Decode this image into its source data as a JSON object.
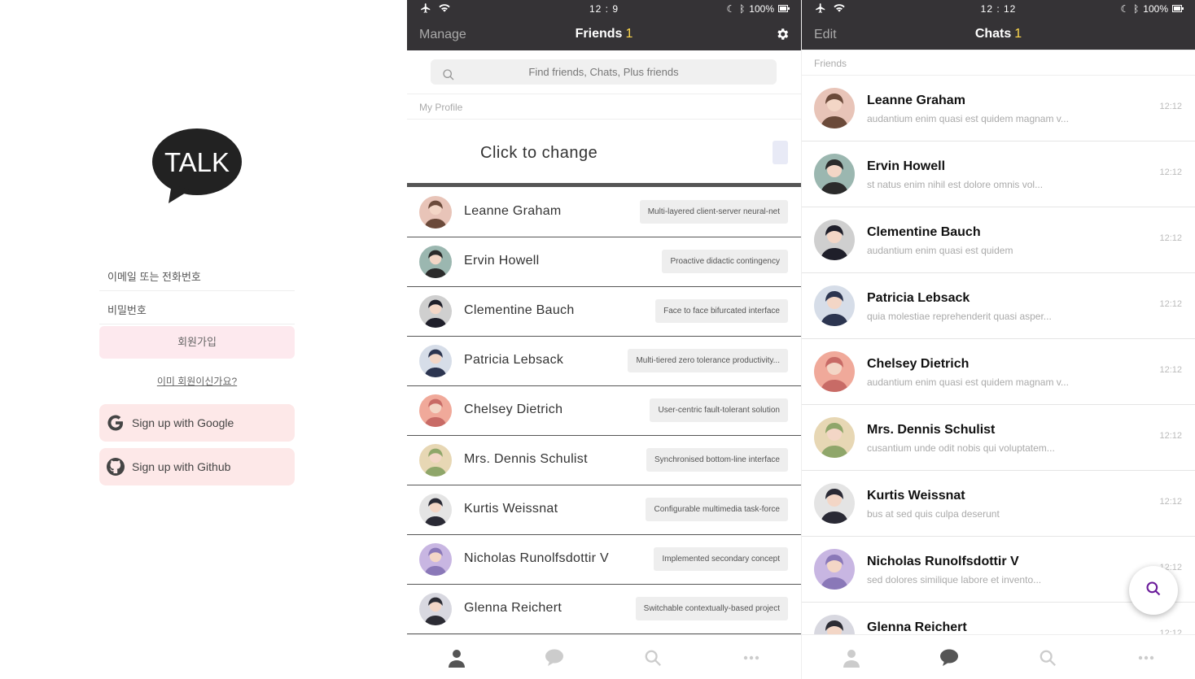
{
  "login": {
    "logo_text": "TALK",
    "email_placeholder": "이메일 또는 전화번호",
    "password_placeholder": "비밀번호",
    "signup_label": "회원가입",
    "already_member": "이미 회원이신가요?",
    "google_label": "Sign up with Google",
    "github_label": "Sign up with Github"
  },
  "friends_screen": {
    "status": {
      "time": "12 : 9",
      "battery": "100%"
    },
    "nav": {
      "left": "Manage",
      "title": "Friends",
      "count": "1"
    },
    "search_placeholder": "Find friends, Chats, Plus friends",
    "my_profile_label": "My Profile",
    "profile_text": "Click to change",
    "friends": [
      {
        "name": "Leanne Graham",
        "status": "Multi-layered client-server neural-net"
      },
      {
        "name": "Ervin Howell",
        "status": "Proactive didactic contingency"
      },
      {
        "name": "Clementine Bauch",
        "status": "Face to face bifurcated interface"
      },
      {
        "name": "Patricia Lebsack",
        "status": "Multi-tiered zero tolerance productivity..."
      },
      {
        "name": "Chelsey Dietrich",
        "status": "User-centric fault-tolerant solution"
      },
      {
        "name": "Mrs. Dennis Schulist",
        "status": "Synchronised bottom-line interface"
      },
      {
        "name": "Kurtis Weissnat",
        "status": "Configurable multimedia task-force"
      },
      {
        "name": "Nicholas Runolfsdottir V",
        "status": "Implemented secondary concept"
      },
      {
        "name": "Glenna Reichert",
        "status": "Switchable contextually-based project"
      }
    ]
  },
  "chats_screen": {
    "status": {
      "time": "12 : 12",
      "battery": "100%"
    },
    "nav": {
      "left": "Edit",
      "title": "Chats",
      "count": "1"
    },
    "section_label": "Friends",
    "chats": [
      {
        "name": "Leanne Graham",
        "message": "audantium enim quasi est quidem magnam v...",
        "time": "12:12"
      },
      {
        "name": "Ervin Howell",
        "message": "st natus enim nihil est dolore omnis vol...",
        "time": "12:12"
      },
      {
        "name": "Clementine Bauch",
        "message": "audantium enim quasi est quidem",
        "time": "12:12"
      },
      {
        "name": "Patricia Lebsack",
        "message": "quia molestiae reprehenderit quasi asper...",
        "time": "12:12"
      },
      {
        "name": "Chelsey Dietrich",
        "message": "audantium enim quasi est quidem magnam v...",
        "time": "12:12"
      },
      {
        "name": "Mrs. Dennis Schulist",
        "message": "cusantium unde odit nobis qui voluptatem...",
        "time": "12:12"
      },
      {
        "name": "Kurtis Weissnat",
        "message": "bus at sed quis culpa deserunt",
        "time": "12:12"
      },
      {
        "name": "Nicholas Runolfsdottir V",
        "message": "sed dolores similique labore et invento...",
        "time": "12:12"
      },
      {
        "name": "Glenna Reichert",
        "message": "",
        "time": "12:12"
      }
    ]
  },
  "colors": {
    "header_bg": "#353336",
    "count_yellow": "#ffd84d",
    "signup_pink": "#fde9ee",
    "social_pink": "#fde8e8",
    "fab_icon": "#6a1b9a"
  },
  "icons": {
    "status_left": [
      "airplane-icon",
      "wifi-icon"
    ],
    "status_right": [
      "moon-icon",
      "bluetooth-icon",
      "battery-icon"
    ],
    "tabbar": [
      "person-icon",
      "chat-bubble-icon",
      "search-icon",
      "more-icon"
    ]
  }
}
